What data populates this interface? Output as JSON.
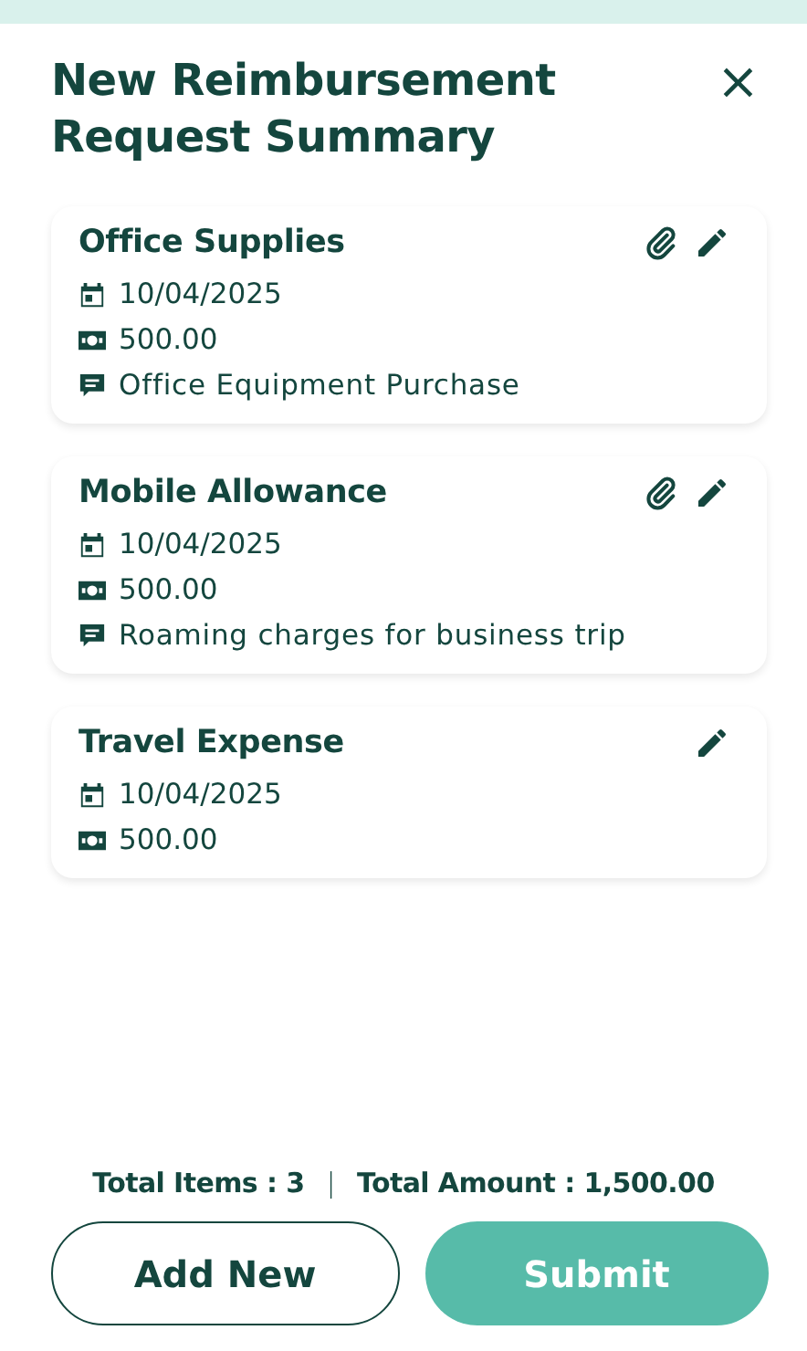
{
  "title": "New Reimbursement Request Summary",
  "close_label": "×",
  "items": [
    {
      "name": "Office Supplies",
      "attachment": true,
      "date": "10/04/2025",
      "amount": "500.00",
      "comment": "Office Equipment Purchase"
    },
    {
      "name": "Mobile Allowance",
      "attachment": true,
      "date": "10/04/2025",
      "amount": "500.00",
      "comment": "Roaming charges for business trip"
    },
    {
      "name": "Travel Expense",
      "attachment": false,
      "date": "10/04/2025",
      "amount": "500.00"
    }
  ],
  "summary": {
    "total_items": "Total Items : 3",
    "separator": "|",
    "total_amount": "Total Amount : 1,500.00"
  },
  "buttons": [
    {
      "label": "Add New",
      "kind": "outline"
    },
    {
      "label": "Submit",
      "kind": "primary"
    }
  ]
}
